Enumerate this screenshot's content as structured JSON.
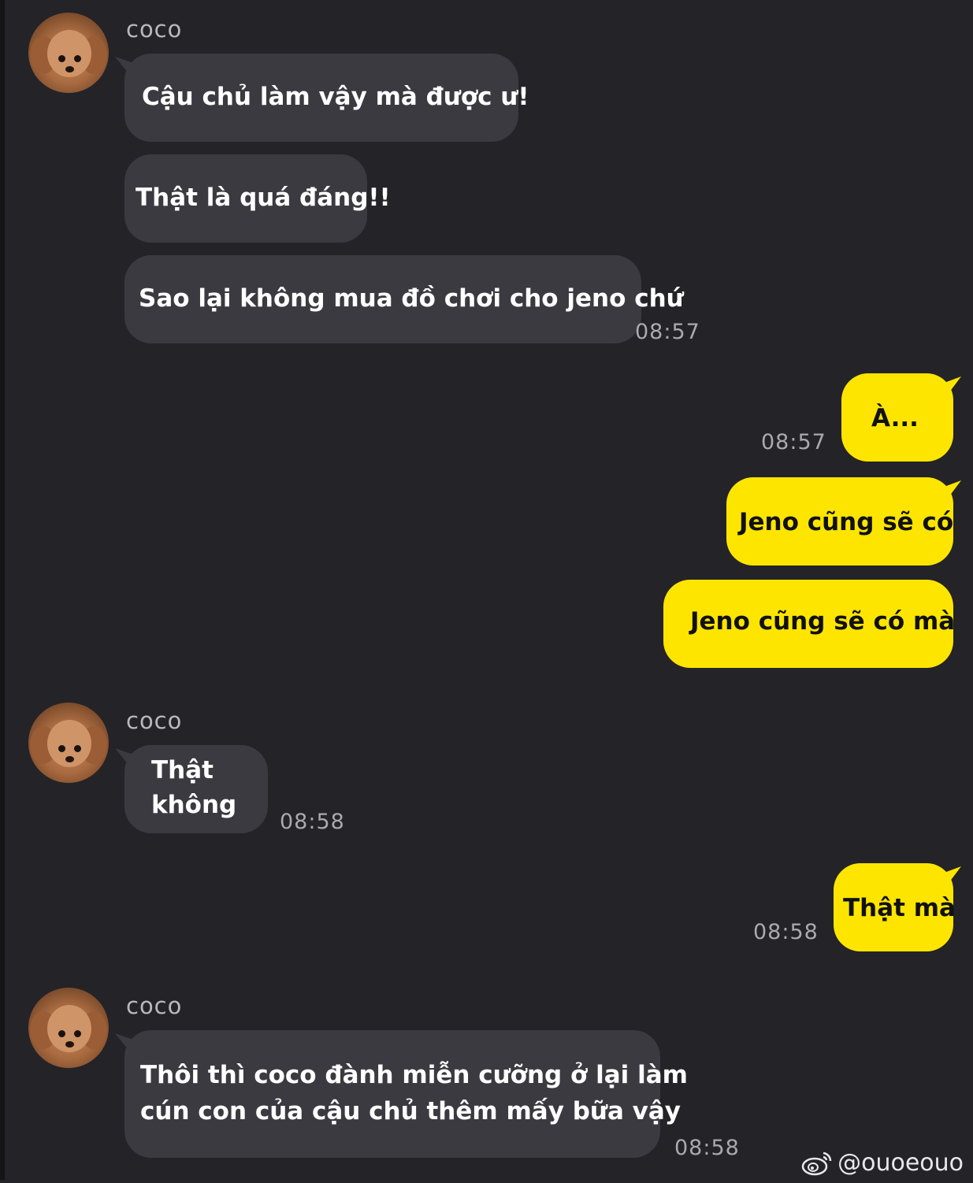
{
  "messages": [
    {
      "type": "in",
      "sender": "coco",
      "text": "Cậu chủ làm vậy mà được ư!"
    },
    {
      "type": "in",
      "text": "Thật là quá đáng!!"
    },
    {
      "type": "in",
      "text": "Sao lại không mua đồ chơi cho jeno chứ",
      "time": "08:57"
    },
    {
      "type": "out",
      "text": "À...",
      "time": "08:57"
    },
    {
      "type": "out",
      "text": "Jeno cũng sẽ có"
    },
    {
      "type": "out",
      "text": "Jeno cũng sẽ có mà"
    },
    {
      "type": "in",
      "sender": "coco",
      "text": "Thật\nkhông",
      "time": "08:58"
    },
    {
      "type": "out",
      "text": "Thật mà",
      "time": "08:58"
    },
    {
      "type": "in",
      "sender": "coco",
      "text": "Thôi thì coco đành miễn cưỡng ở lại làm\ncún con của cậu chủ thêm mấy bữa vậy",
      "time": "08:58"
    }
  ],
  "watermark": {
    "text": "@ouoeouo",
    "icon": "weibo-icon"
  },
  "colors": {
    "background": "#242328",
    "incoming": "#3b3a40",
    "outgoing": "#fee500"
  }
}
